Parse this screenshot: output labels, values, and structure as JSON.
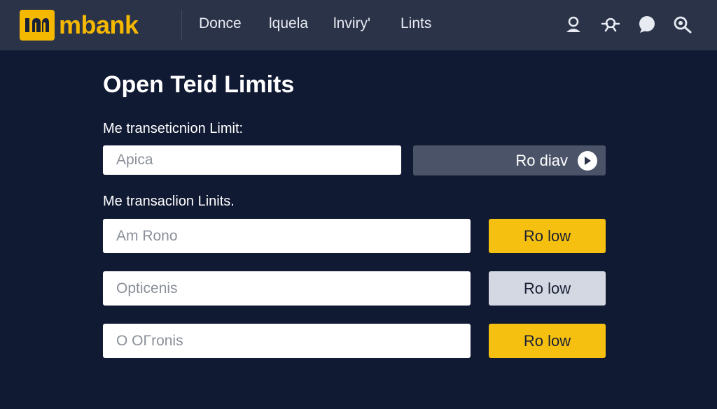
{
  "header": {
    "logo_mark": "m",
    "logo_text": "mbank",
    "nav": [
      "Donce",
      "lquela",
      "lnviry'",
      "Lints"
    ],
    "icons": [
      "user-icon",
      "network-icon",
      "chat-icon",
      "search-icon"
    ]
  },
  "main": {
    "title": "Open Teid Limits",
    "section1": {
      "label": "Me transeticnion Limit:",
      "input_value": "Apica",
      "button_label": "Ro diav"
    },
    "section2": {
      "label": "Me transaclion Linits.",
      "rows": [
        {
          "input_value": "Am Rono",
          "button_label": "Ro low",
          "style": "yellow"
        },
        {
          "input_value": "Opticenis",
          "button_label": "Ro low",
          "style": "grey"
        },
        {
          "input_value": "O OΓronis",
          "button_label": "Ro low",
          "style": "yellow"
        }
      ]
    }
  },
  "colors": {
    "background": "#111a33",
    "topbar": "#2a3348",
    "accent": "#f5c010",
    "button_dark": "#4a5368",
    "button_grey": "#d3d8e2"
  }
}
